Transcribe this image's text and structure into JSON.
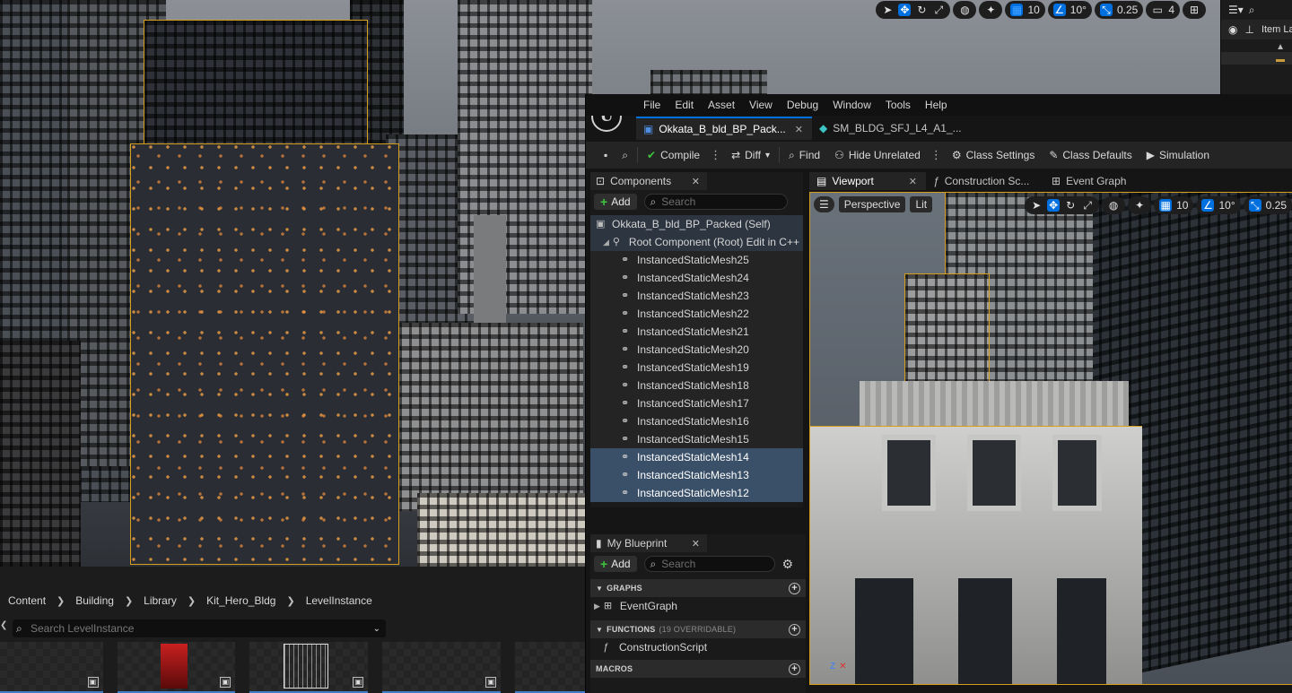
{
  "level_toolbar": {
    "grid_snap": "10",
    "rotation_snap": "10°",
    "scale_snap": "0.25",
    "camera_speed": "4"
  },
  "outliner": {
    "column_label": "Item La"
  },
  "content_browser": {
    "breadcrumb": [
      "Content",
      "Building",
      "Library",
      "Kit_Hero_Bldg",
      "LevelInstance"
    ],
    "search_placeholder": "Search LevelInstance"
  },
  "menu": [
    "File",
    "Edit",
    "Asset",
    "View",
    "Debug",
    "Window",
    "Tools",
    "Help"
  ],
  "doc_tabs": [
    {
      "label": "Okkata_B_bld_BP_Pack..."
    },
    {
      "label": "SM_BLDG_SFJ_L4_A1_..."
    }
  ],
  "toolbar": {
    "compile": "Compile",
    "diff": "Diff",
    "find": "Find",
    "hide_unrelated": "Hide Unrelated",
    "class_settings": "Class Settings",
    "class_defaults": "Class Defaults",
    "simulation": "Simulation"
  },
  "components": {
    "tab_label": "Components",
    "add_label": "Add",
    "search_placeholder": "Search",
    "self_label": "Okkata_B_bld_BP_Packed (Self)",
    "root_label": "Root Component (Root)",
    "edit_cpp": "Edit in C++",
    "items": [
      {
        "label": "InstancedStaticMesh25",
        "selected": false
      },
      {
        "label": "InstancedStaticMesh24",
        "selected": false
      },
      {
        "label": "InstancedStaticMesh23",
        "selected": false
      },
      {
        "label": "InstancedStaticMesh22",
        "selected": false
      },
      {
        "label": "InstancedStaticMesh21",
        "selected": false
      },
      {
        "label": "InstancedStaticMesh20",
        "selected": false
      },
      {
        "label": "InstancedStaticMesh19",
        "selected": false
      },
      {
        "label": "InstancedStaticMesh18",
        "selected": false
      },
      {
        "label": "InstancedStaticMesh17",
        "selected": false
      },
      {
        "label": "InstancedStaticMesh16",
        "selected": false
      },
      {
        "label": "InstancedStaticMesh15",
        "selected": false
      },
      {
        "label": "InstancedStaticMesh14",
        "selected": true
      },
      {
        "label": "InstancedStaticMesh13",
        "selected": true
      },
      {
        "label": "InstancedStaticMesh12",
        "selected": true
      }
    ]
  },
  "my_blueprint": {
    "tab_label": "My Blueprint",
    "add_label": "Add",
    "search_placeholder": "Search",
    "graphs_header": "GRAPHS",
    "event_graph": "EventGraph",
    "functions_header": "FUNCTIONS",
    "functions_count": "(19 OVERRIDABLE)",
    "construction_script": "ConstructionScript",
    "macros_header": "MACROS"
  },
  "viewport_tabs": [
    {
      "label": "Viewport",
      "active": true
    },
    {
      "label": "Construction Sc...",
      "active": false
    },
    {
      "label": "Event Graph",
      "active": false
    }
  ],
  "viewport": {
    "perspective": "Perspective",
    "lit": "Lit",
    "grid_snap": "10",
    "rotation_snap": "10°",
    "scale_snap": "0.25"
  },
  "colors": {
    "accent": "#0070e0",
    "selection": "#3a5069",
    "highlight_outline": "#d69e1c"
  }
}
